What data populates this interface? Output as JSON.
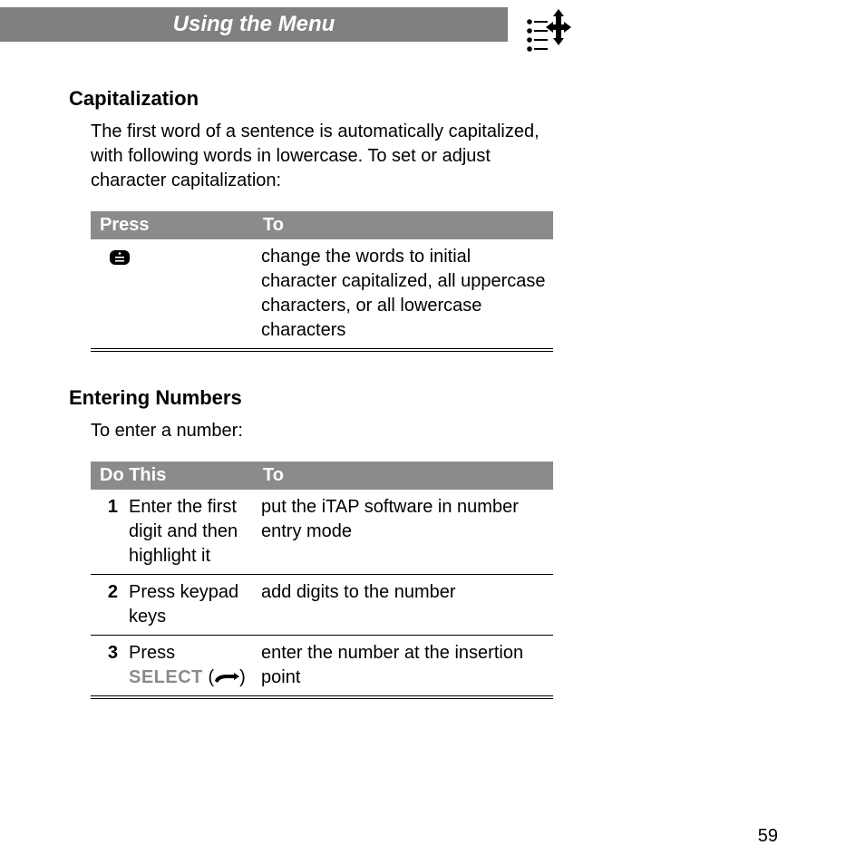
{
  "header": {
    "title": "Using the Menu"
  },
  "sections": {
    "cap": {
      "heading": "Capitalization",
      "intro": "The first word of a sentence is automatically capitalized, with following words in lowercase. To set or adjust character capitalization:",
      "table": {
        "headers": {
          "press": "Press",
          "to": "To"
        },
        "rows": [
          {
            "press_icon": "menu-key",
            "to": "change the words to initial character capitalized, all uppercase characters, or all lowercase characters"
          }
        ]
      }
    },
    "num": {
      "heading": "Entering Numbers",
      "intro": "To enter a number:",
      "table": {
        "headers": {
          "do": "Do This",
          "to": "To"
        },
        "rows": [
          {
            "n": "1",
            "do": "Enter the first digit and then highlight it",
            "to": "put the iTAP software in number entry mode"
          },
          {
            "n": "2",
            "do": "Press keypad keys",
            "to": "add digits to the number"
          },
          {
            "n": "3",
            "do_prefix": "Press",
            "do_softkey": "SELECT",
            "do_suffix": "(",
            "do_close": ")",
            "to": "enter the number at the insertion point"
          }
        ]
      }
    }
  },
  "page_number": "59"
}
